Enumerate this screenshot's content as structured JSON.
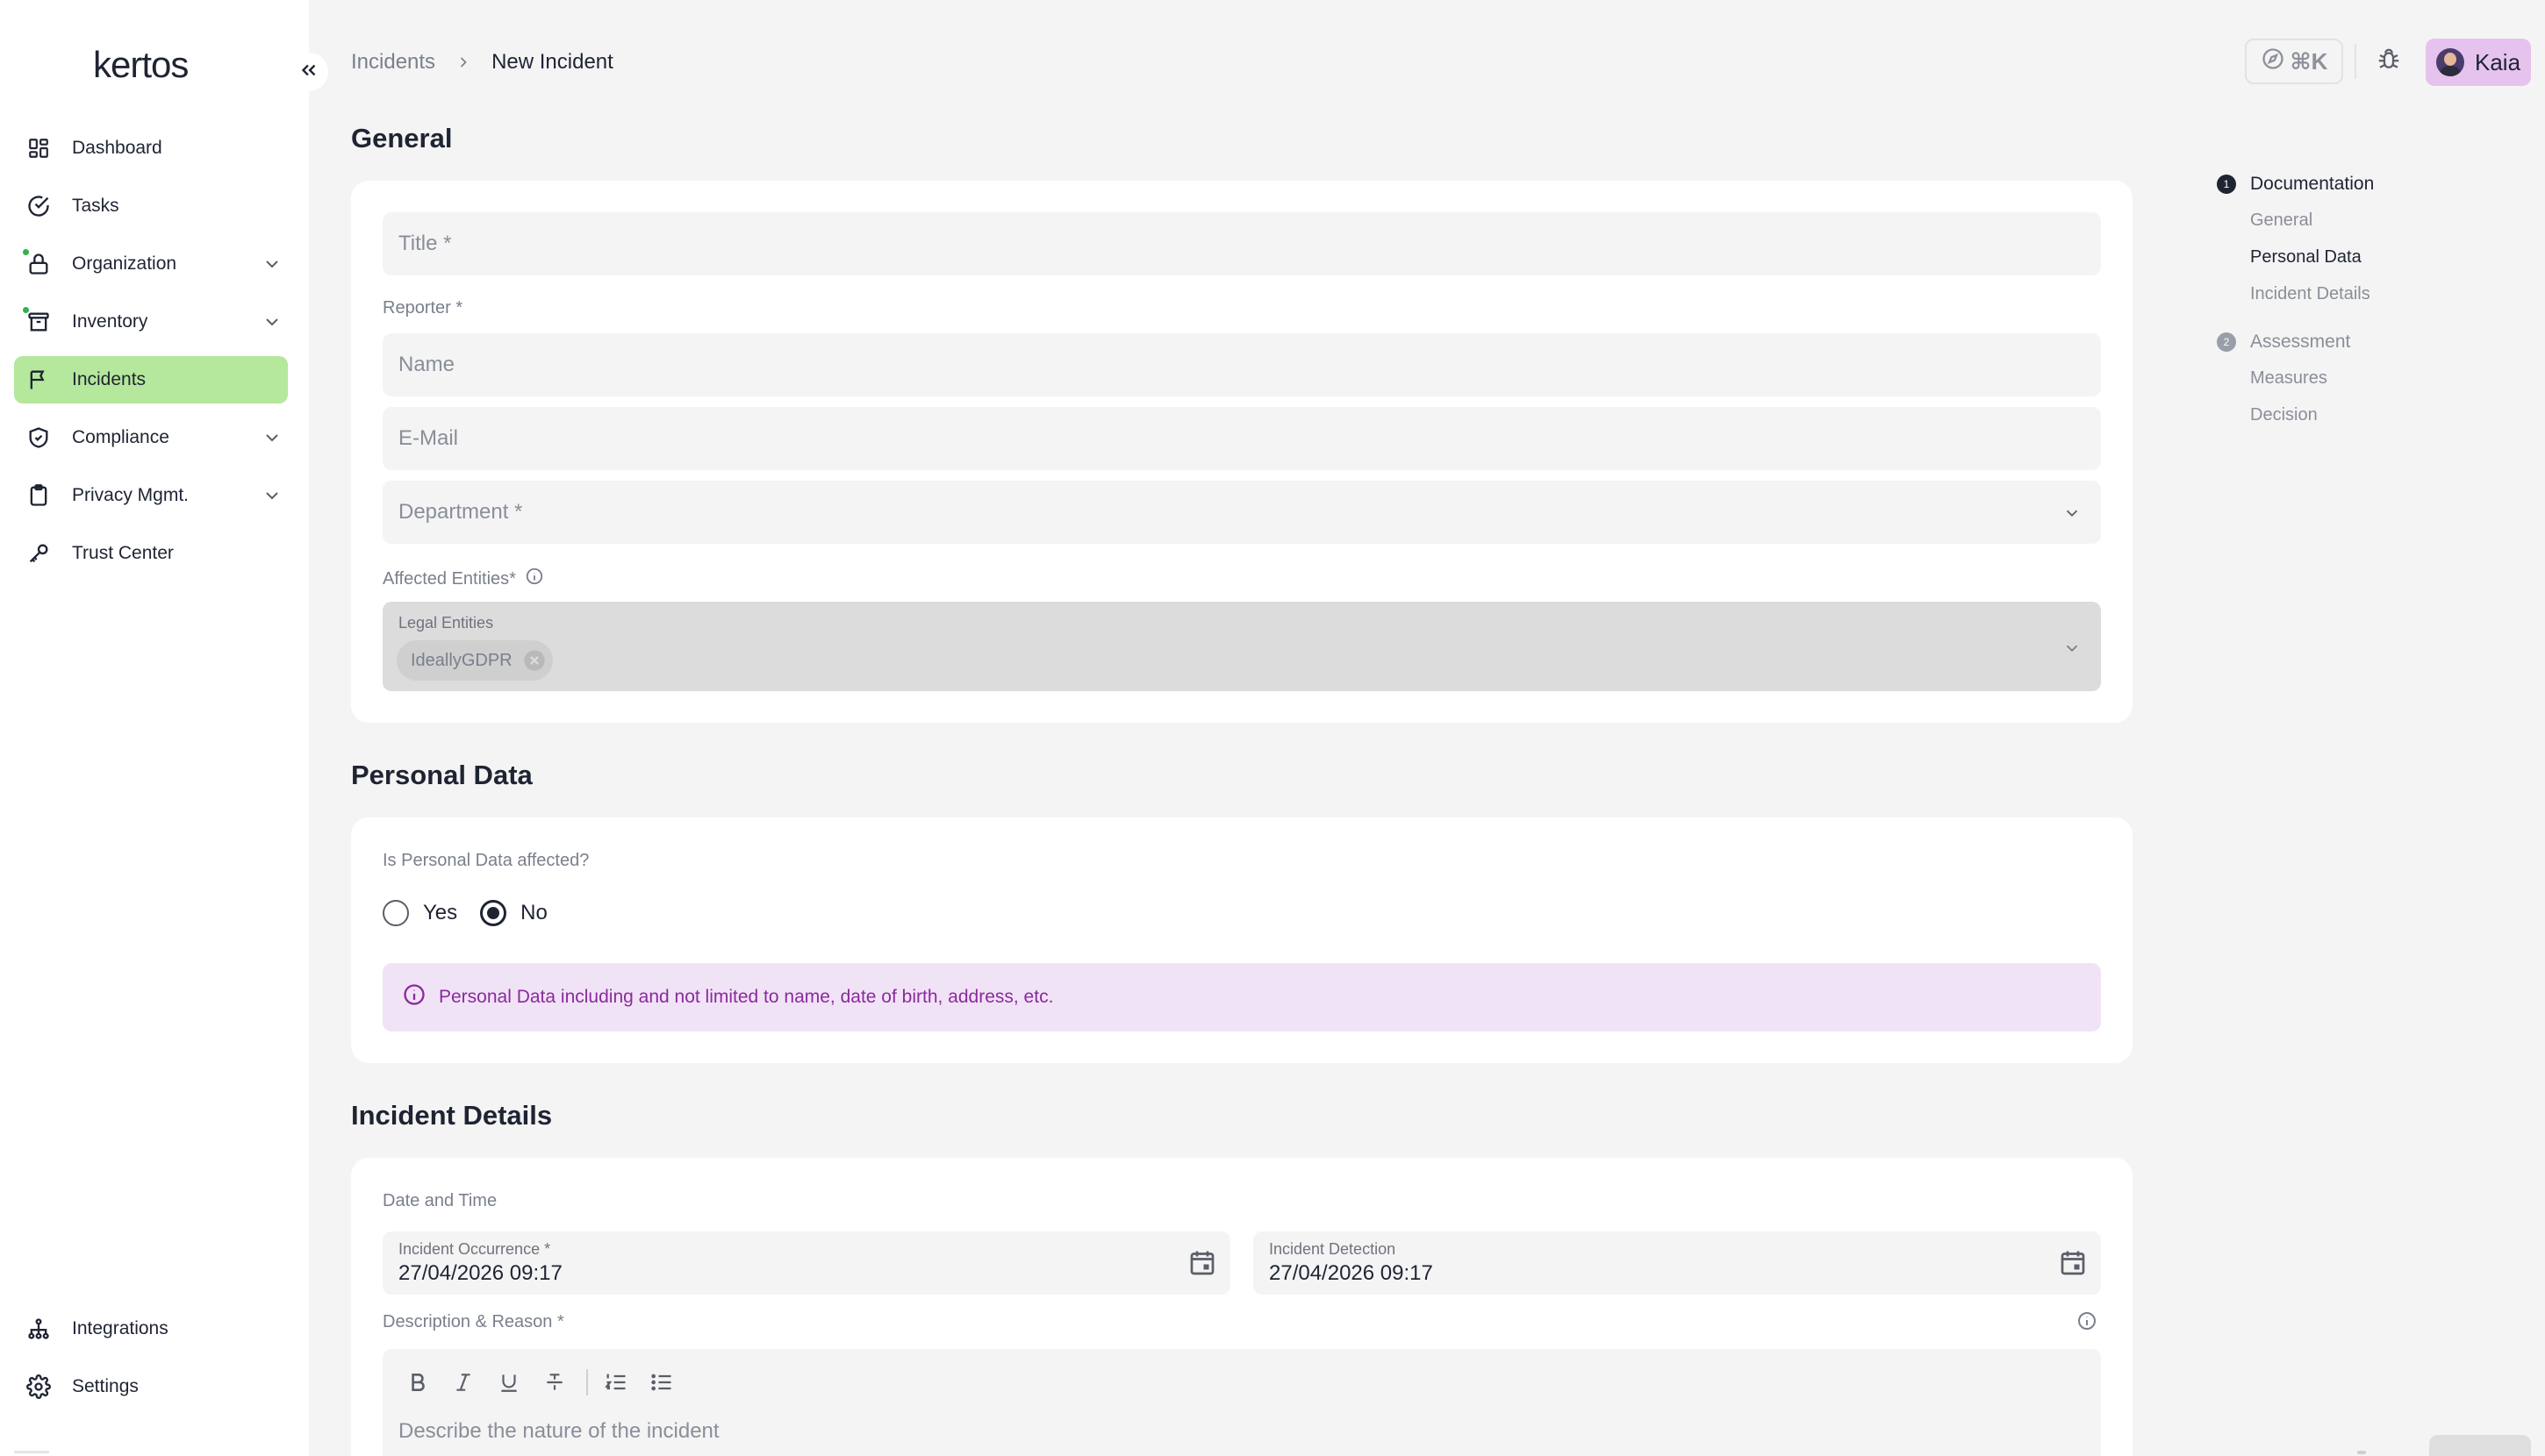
{
  "app": {
    "logo": "kertos"
  },
  "sidebar": {
    "items": [
      {
        "label": "Dashboard",
        "icon": "grid-icon",
        "has_chevron": false,
        "dot": false,
        "active": false
      },
      {
        "label": "Tasks",
        "icon": "check-circle-icon",
        "has_chevron": false,
        "dot": false,
        "active": false
      },
      {
        "label": "Organization",
        "icon": "lock-icon",
        "has_chevron": true,
        "dot": true,
        "active": false
      },
      {
        "label": "Inventory",
        "icon": "archive-icon",
        "has_chevron": true,
        "dot": true,
        "active": false
      },
      {
        "label": "Incidents",
        "icon": "flag-icon",
        "has_chevron": false,
        "dot": false,
        "active": true
      },
      {
        "label": "Compliance",
        "icon": "shield-check-icon",
        "has_chevron": true,
        "dot": false,
        "active": false
      },
      {
        "label": "Privacy Mgmt.",
        "icon": "clipboard-icon",
        "has_chevron": true,
        "dot": false,
        "active": false
      },
      {
        "label": "Trust Center",
        "icon": "key-icon",
        "has_chevron": false,
        "dot": false,
        "active": false
      }
    ],
    "bottom_items": [
      {
        "label": "Integrations",
        "icon": "sitemap-icon"
      },
      {
        "label": "Settings",
        "icon": "gear-icon"
      }
    ],
    "active_color": "#b5e79c",
    "dot_color": "#2fb34a"
  },
  "header": {
    "breadcrumb": {
      "parent": "Incidents",
      "current": "New Incident"
    },
    "command_shortcut": "⌘K",
    "user": {
      "name": "Kaia"
    },
    "user_badge_color": "#e6c3ef"
  },
  "general": {
    "title": "General",
    "title_placeholder": "Title *",
    "reporter_label": "Reporter *",
    "name_placeholder": "Name",
    "email_placeholder": "E-Mail",
    "department_placeholder": "Department *",
    "affected_entities_label": "Affected Entities*",
    "legal_entities_label": "Legal Entities",
    "entity_chip": "IdeallyGDPR"
  },
  "personal_data": {
    "title": "Personal Data",
    "question": "Is Personal Data affected?",
    "options": [
      {
        "label": "Yes",
        "checked": false
      },
      {
        "label": "No",
        "checked": true
      }
    ],
    "info": "Personal Data including and not limited to name, date of birth, address, etc.",
    "info_color": "#8a2a9e"
  },
  "incident_details": {
    "title": "Incident Details",
    "date_time_label": "Date and Time",
    "occurrence_label": "Incident Occurrence *",
    "occurrence_value": "27/04/2026 09:17",
    "detection_label": "Incident Detection",
    "detection_value": "27/04/2026 09:17",
    "description_label": "Description & Reason *",
    "description_placeholder": "Describe the nature of the incident",
    "toolbar": [
      "bold-icon",
      "italic-icon",
      "underline-icon",
      "strikethrough-icon",
      "ordered-list-icon",
      "bullet-list-icon"
    ]
  },
  "toc": {
    "steps": [
      {
        "number": "1",
        "label": "Documentation",
        "active": true,
        "subs": [
          {
            "label": "General",
            "current": false
          },
          {
            "label": "Personal Data",
            "current": true
          },
          {
            "label": "Incident Details",
            "current": false
          }
        ]
      },
      {
        "number": "2",
        "label": "Assessment",
        "active": false,
        "subs": [
          {
            "label": "Measures",
            "current": false
          },
          {
            "label": "Decision",
            "current": false
          }
        ]
      }
    ]
  }
}
